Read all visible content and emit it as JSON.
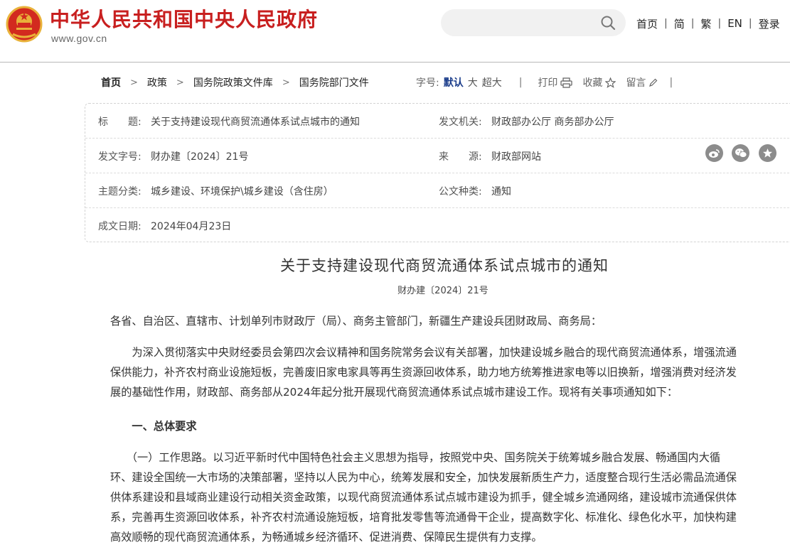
{
  "site": {
    "name": "中华人民共和国中央人民政府",
    "domain": "www.gov.cn"
  },
  "search": {
    "placeholder": "",
    "value": ""
  },
  "top_nav": [
    "首页",
    "简",
    "繁",
    "EN",
    "登录"
  ],
  "breadcrumb": [
    "首页",
    "政策",
    "国务院政策文件库",
    "国务院部门文件"
  ],
  "tools": {
    "font_label": "字号:",
    "font_sizes": [
      "默认",
      "大",
      "超大"
    ],
    "print": "打印",
    "favorite": "收藏",
    "comment": "留言"
  },
  "meta": {
    "title_key": "标　　题:",
    "title_val": "关于支持建设现代商贸流通体系试点城市的通知",
    "issuer_key": "发文机关:",
    "issuer_val": "财政部办公厅 商务部办公厅",
    "docno_key": "发文字号:",
    "docno_val": "财办建〔2024〕21号",
    "source_key": "来　　源:",
    "source_val": "财政部网站",
    "topic_key": "主题分类:",
    "topic_val": "城乡建设、环境保护\\城乡建设（含住房）",
    "type_key": "公文种类:",
    "type_val": "通知",
    "date_key": "成文日期:",
    "date_val": "2024年04月23日"
  },
  "article": {
    "title": "关于支持建设现代商贸流通体系试点城市的通知",
    "docno": "财办建〔2024〕21号",
    "salutation": "各省、自治区、直辖市、计划单列市财政厅（局）、商务主管部门，新疆生产建设兵团财政局、商务局：",
    "intro_lines": [
      "　　为深入贯彻落实中央财经委员会第四次会议精神和国务院常务会议有关部署，加快建设城乡融合的现代商贸流通体系，增强流通",
      "保供能力，补齐农村商业设施短板，完善废旧家电家具等再生资源回收体系，助力地方统筹推进家电等以旧换新，增强消费对经济发",
      "展的基础性作用，财政部、商务部从2024年起分批开展现代商贸流通体系试点城市建设工作。现将有关事项通知如下："
    ],
    "heading1": "　　一、总体要求",
    "para1_lines": [
      "　　（一）工作思路。以习近平新时代中国特色社会主义思想为指导，按照党中央、国务院关于统筹城乡融合发展、畅通国内大循",
      "环、建设全国统一大市场的决策部署，坚持以人民为中心，统筹发展和安全，加快发展新质生产力，适度整合现行生活必需品流通保",
      "供体系建设和县域商业建设行动相关资金政策，以现代商贸流通体系试点城市建设为抓手，健全城乡流通网络，建设城市流通保供体",
      "系，完善再生资源回收体系，补齐农村流通设施短板，培育批发零售等流通骨干企业，提高数字化、标准化、绿色化水平，加快构建",
      "高效顺畅的现代商贸流通体系，为畅通城乡经济循环、促进消费、保障民生提供有力支撑。"
    ]
  },
  "colors": {
    "brand_red": "#c81f1f",
    "active_blue": "#1a3c8a",
    "share_gray": "#8c8c8c"
  },
  "icons": [
    "emblem-icon",
    "search-icon",
    "print-icon",
    "star-icon",
    "pencil-icon",
    "weibo-icon",
    "wechat-icon",
    "qzone-icon"
  ]
}
